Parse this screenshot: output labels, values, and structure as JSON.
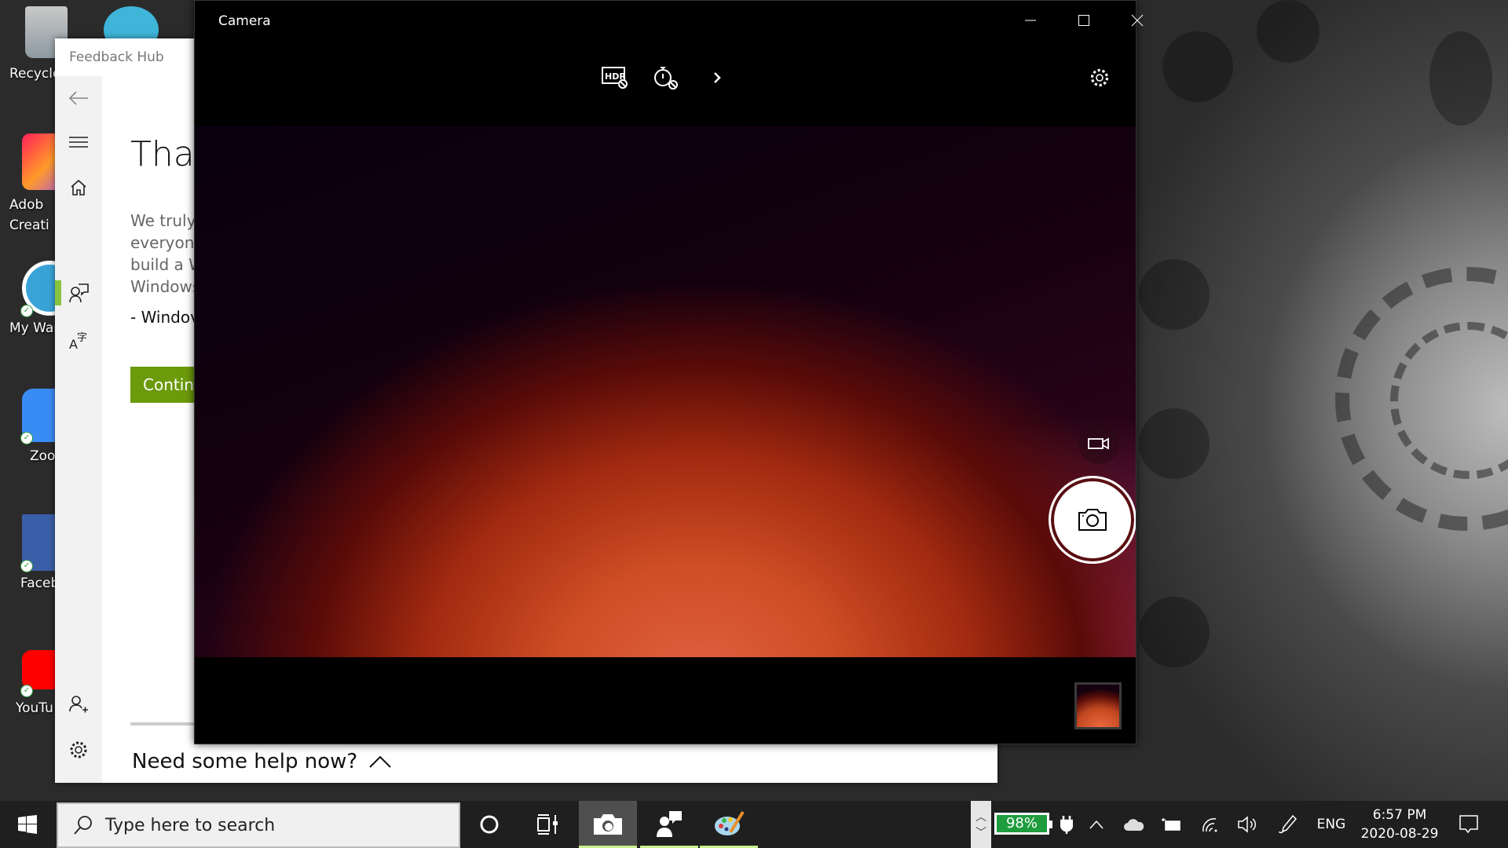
{
  "desktop": {
    "icons": [
      {
        "label": "Recycle",
        "icon": "recycle-bin-icon"
      },
      {
        "label": "Adob\nCreati",
        "icon": "adobe-creative-cloud-icon"
      },
      {
        "label": "My Warr",
        "icon": "my-warranty-icon"
      },
      {
        "label": "Zoon",
        "icon": "zoom-icon"
      },
      {
        "label": "Facebo",
        "icon": "facebook-icon"
      },
      {
        "label": "YouTu",
        "icon": "youtube-icon"
      }
    ]
  },
  "feedback_hub": {
    "title": "Feedback Hub",
    "heading": "Than",
    "body_lines": [
      "We truly",
      "everyone",
      "build a W",
      "Windows"
    ],
    "signature": "- Windov",
    "continue_label": "Continu",
    "help_label": "Need some help now?",
    "nav": [
      "back",
      "menu",
      "home",
      "feedback",
      "announcements",
      "add-account",
      "settings"
    ],
    "active_nav": "feedback",
    "accent": "#8ac43f",
    "button_color": "#6b9a0b"
  },
  "camera": {
    "title": "Camera",
    "window_controls": [
      "minimize",
      "maximize",
      "close"
    ],
    "toolbar": [
      "hdr-off",
      "timer-off",
      "more"
    ],
    "settings": "settings",
    "mode_video": "video",
    "mode_photo": "photo"
  },
  "taskbar": {
    "search_placeholder": "Type here to search",
    "apps": [
      "Camera",
      "Feedback Hub",
      "Paint 3D"
    ],
    "active_app": "Camera",
    "battery_percent": "98%",
    "language": "ENG",
    "time": "6:57 PM",
    "date": "2020-08-29"
  }
}
